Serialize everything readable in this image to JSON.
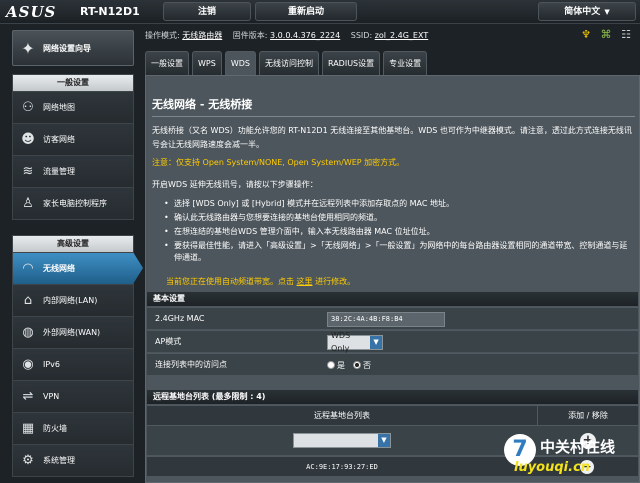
{
  "header": {
    "brand": "ASUS",
    "model": "RT-N12D1",
    "logout_label": "注销",
    "reboot_label": "重新启动",
    "language": "简体中文"
  },
  "status": {
    "mode_label": "操作模式:",
    "mode_value": "无线路由器",
    "firmware_label": "固件版本:",
    "firmware_value": "3.0.0.4.376_2224",
    "ssid_label": "SSID:",
    "ssid_value": "zol_2.4G_EXT",
    "icons": [
      "usb-icon",
      "network-icon",
      "clients-icon"
    ]
  },
  "sidebar": {
    "wizard_label": "网络设置向导",
    "general_title": "一般设置",
    "general_items": [
      {
        "label": "网络地图",
        "icon": "network-map-icon"
      },
      {
        "label": "访客网络",
        "icon": "guest-network-icon"
      },
      {
        "label": "流量管理",
        "icon": "traffic-icon"
      },
      {
        "label": "家长电脑控制程序",
        "icon": "parental-icon"
      }
    ],
    "advanced_title": "高级设置",
    "advanced_items": [
      {
        "label": "无线网络",
        "icon": "wifi-icon"
      },
      {
        "label": "内部网络(LAN)",
        "icon": "lan-icon"
      },
      {
        "label": "外部网络(WAN)",
        "icon": "wan-icon"
      },
      {
        "label": "IPv6",
        "icon": "ipv6-icon"
      },
      {
        "label": "VPN",
        "icon": "vpn-icon"
      },
      {
        "label": "防火墙",
        "icon": "firewall-icon"
      },
      {
        "label": "系统管理",
        "icon": "admin-icon"
      }
    ]
  },
  "tabs": [
    "一般设置",
    "WPS",
    "WDS",
    "无线访问控制",
    "RADIUS设置",
    "专业设置"
  ],
  "main": {
    "title": "无线网络 - 无线桥接",
    "description": "无线桥接（又名 WDS）功能允许您的 RT-N12D1 无线连接至其他基地台。WDS 也可作为中继器模式。请注意，透过此方式连接无线讯号会让无线网路速度会减一半。",
    "note": "注意：仅支持 Open System/NONE, Open System/WEP 加密方式。",
    "intro": "开启WDS 延伸无线讯号，请按以下步骤操作：",
    "steps": [
      "选择 [WDS Only] 或 [Hybrid] 模式并在远程列表中添加存取点的 MAC 地址。",
      "确认此无线路由器与您想要连接的基地台使用相同的频道。",
      "在想连结的基地台WDS 管理介面中，输入本无线路由器 MAC 位址位址。",
      "要获得最佳性能，请进入「高级设置」>「无线网络」>「一般设置」为网络中的每台路由器设置相同的通道带宽、控制通道与延伸通道。"
    ],
    "autochannel_prefix": "当前您正在使用自动频道带宽。点击",
    "autochannel_link": "这里",
    "autochannel_suffix": "进行修改。"
  },
  "basic": {
    "head": "基本设置",
    "mac_label": "2.4GHz MAC",
    "mac_value": "38:2C:4A:4B:F8:B4",
    "ap_label": "AP模式",
    "ap_value": "WDS Only",
    "connect_label": "连接列表中的访问点",
    "yes_label": "是",
    "no_label": "否"
  },
  "remote": {
    "head": "远程基地台列表 (最多限制 : 4)",
    "col_list": "远程基地台列表",
    "col_action": "添加 / 移除",
    "entries": [
      "AC:9E:17:93:27:ED"
    ]
  },
  "watermark": {
    "mark": "7",
    "cn": "中关村在线",
    "en": "luyouqi.cn"
  }
}
